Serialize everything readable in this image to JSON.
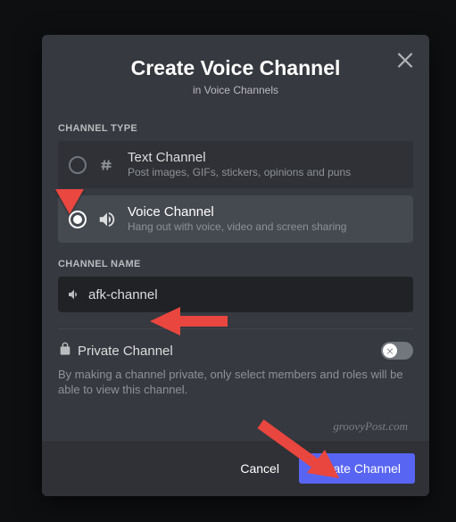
{
  "header": {
    "title": "Create Voice Channel",
    "subtitle": "in Voice Channels"
  },
  "labels": {
    "channel_type": "CHANNEL TYPE",
    "channel_name": "CHANNEL NAME"
  },
  "types": {
    "text": {
      "title": "Text Channel",
      "desc": "Post images, GIFs, stickers, opinions and puns"
    },
    "voice": {
      "title": "Voice Channel",
      "desc": "Hang out with voice, video and screen sharing"
    }
  },
  "name_input": {
    "value": "afk-channel"
  },
  "private": {
    "label": "Private Channel",
    "desc": "By making a channel private, only select members and roles will be able to view this channel."
  },
  "footer": {
    "cancel": "Cancel",
    "create": "Create Channel"
  },
  "watermark": "groovyPost.com"
}
